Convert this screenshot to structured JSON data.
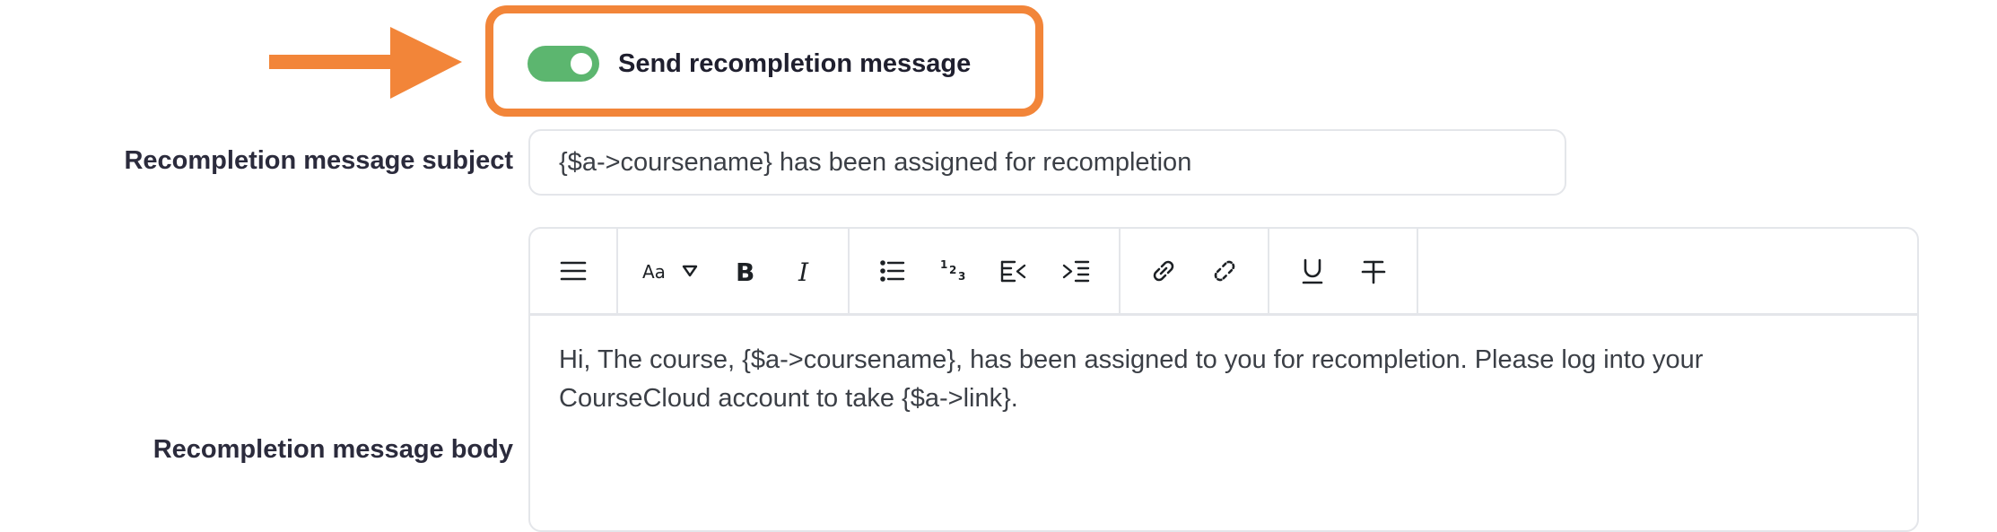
{
  "annotation": {
    "color": "#f28539"
  },
  "toggle": {
    "label": "Send recompletion message",
    "checked": true,
    "color": "#5cb66f"
  },
  "subject": {
    "label": "Recompletion message subject",
    "value": "{$a->coursename} has been assigned for recompletion"
  },
  "body": {
    "label": "Recompletion message body",
    "content": "Hi, The course, {$a->coursename}, has been assigned to you for recompletion. Please log into your CourseCloud account to take {$a->link}."
  },
  "toolbar": {
    "icons": [
      "menu-icon",
      "font-size-icon",
      "bold-icon",
      "italic-icon",
      "bullet-list-icon",
      "numbered-list-icon",
      "outdent-icon",
      "indent-icon",
      "link-icon",
      "unlink-icon",
      "underline-icon",
      "strikethrough-icon"
    ]
  }
}
